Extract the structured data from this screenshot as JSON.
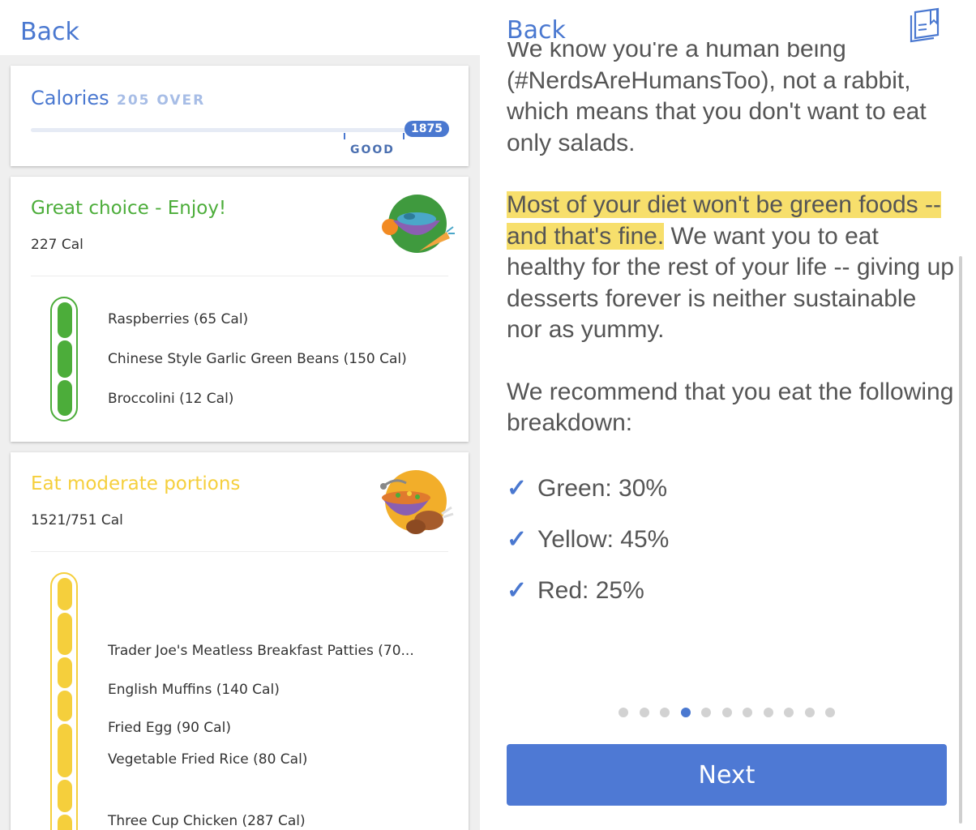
{
  "left": {
    "back_label": "Back",
    "calories": {
      "label": "Calories",
      "status": "205 OVER",
      "good_label": "GOOD",
      "target": "1875",
      "accent": "#4a78d0"
    },
    "green": {
      "title": "Great choice - Enjoy!",
      "calories": "227 Cal",
      "color": "#4cad3a",
      "foods": [
        "Raspberries (65 Cal)",
        "Chinese Style Garlic Green Beans (150 Cal)",
        "Broccolini (12 Cal)"
      ]
    },
    "yellow": {
      "title": "Eat moderate portions",
      "calories": "1521/751 Cal",
      "color": "#f5cf3c",
      "foods": [
        "Trader Joe's Meatless Breakfast Patties (70...",
        "English Muffins (140 Cal)",
        "Fried Egg (90 Cal)",
        "Vegetable Fried Rice (80 Cal)",
        "Three Cup Chicken (287 Cal)"
      ]
    }
  },
  "right": {
    "back_label": "Back",
    "bookmark_icon": "bookmark-icon",
    "paragraph1": "We know you're a human being (#NerdsAreHumansToo), not a rabbit, which means that you don't want to eat only salads.",
    "highlight": "Most of your diet won't be green foods -- and that's fine.",
    "paragraph2_rest": " We want you to eat healthy for the rest of your life -- giving up desserts forever is neither sustainable nor as yummy.",
    "paragraph3": "We recommend that you eat the following breakdown:",
    "breakdown": [
      "Green: 30%",
      "Yellow: 45%",
      "Red: 25%"
    ],
    "page_dots": {
      "total": 11,
      "current": 4
    },
    "next_label": "Next",
    "button_color": "#4e79d4",
    "highlight_color": "#f7df6c"
  }
}
